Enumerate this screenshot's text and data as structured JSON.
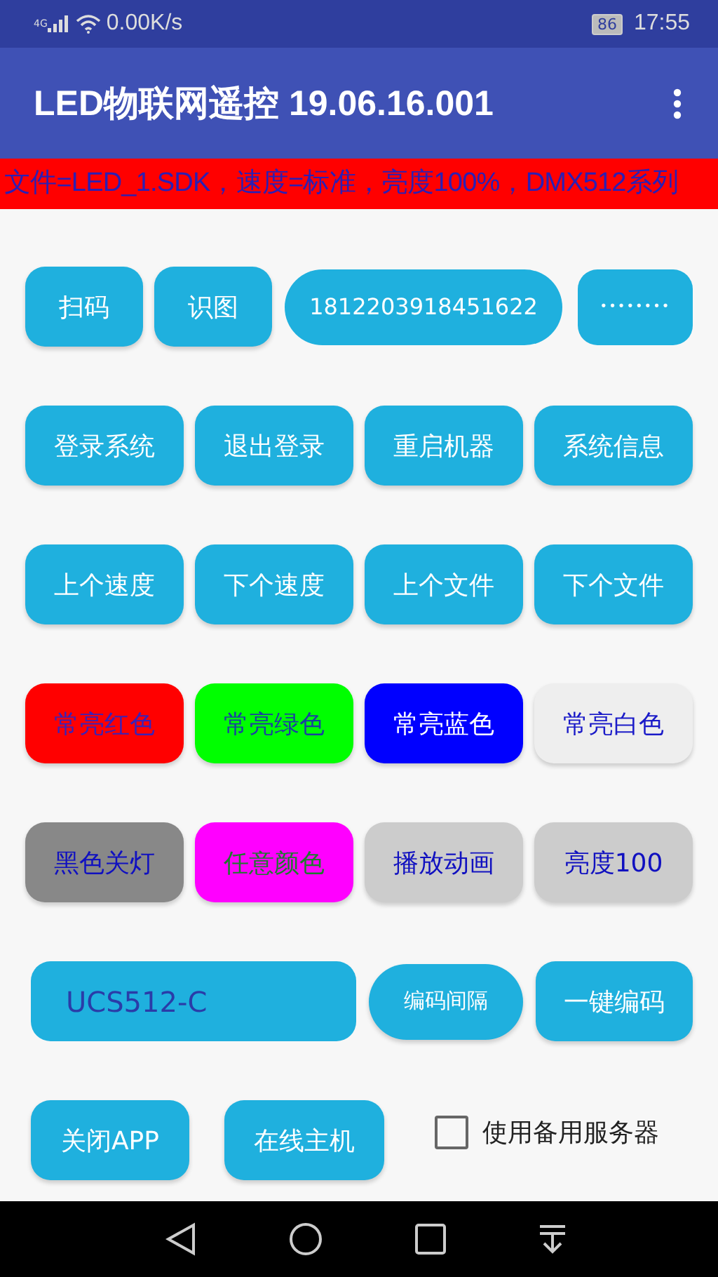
{
  "status_bar": {
    "network": "4G",
    "speed": "0.00K/s",
    "battery": "86",
    "time": "17:55"
  },
  "app_bar": {
    "title": "LED物联网遥控 19.06.16.001"
  },
  "info_banner": "文件=LED_1.SDK，速度=标准，亮度100%，DMX512系列",
  "rows": [
    {
      "items": [
        {
          "kind": "button",
          "label": "扫码"
        },
        {
          "kind": "button",
          "label": "识图"
        },
        {
          "kind": "field",
          "value": "1812203918451622"
        },
        {
          "kind": "password",
          "value": "••••••••"
        }
      ]
    },
    {
      "items": [
        {
          "kind": "button",
          "label": "登录系统"
        },
        {
          "kind": "button",
          "label": "退出登录"
        },
        {
          "kind": "button",
          "label": "重启机器"
        },
        {
          "kind": "button",
          "label": "系统信息"
        }
      ]
    },
    {
      "items": [
        {
          "kind": "button",
          "label": "上个速度"
        },
        {
          "kind": "button",
          "label": "下个速度"
        },
        {
          "kind": "button",
          "label": "上个文件"
        },
        {
          "kind": "button",
          "label": "下个文件"
        }
      ]
    },
    {
      "items": [
        {
          "kind": "button",
          "label": "常亮红色",
          "color": "#ff0000",
          "label_style": {
            "color": "#3a22b8"
          }
        },
        {
          "kind": "button",
          "label": "常亮绿色",
          "color": "#00ff00",
          "label_style": {
            "color": "#1a40a0"
          }
        },
        {
          "kind": "button",
          "label": "常亮蓝色",
          "color": "#0000ff",
          "label_style": {
            "color": "#ffffff"
          }
        },
        {
          "kind": "button",
          "label": "常亮白色",
          "color": "#eeeeee",
          "label_style": {
            "color": "#1a1ac8"
          }
        }
      ]
    },
    {
      "items": [
        {
          "kind": "button",
          "label": "黑色关灯",
          "color": "#888888",
          "label_style": {
            "color": "#1010c0"
          }
        },
        {
          "kind": "button",
          "label": "任意颜色",
          "color": "#ff00ff",
          "label_style": {
            "color": "#1f7a2e"
          }
        },
        {
          "kind": "button",
          "label": "播放动画",
          "color": "#cccccc",
          "label_style": {
            "color": "#1010c0"
          }
        },
        {
          "kind": "button",
          "label": "亮度100",
          "color": "#cccccc",
          "label_style": {
            "color": "#1010c0"
          }
        }
      ]
    },
    {
      "items": [
        {
          "kind": "field",
          "value": "UCS512-C"
        },
        {
          "kind": "pill",
          "label": "编码间隔"
        },
        {
          "kind": "button",
          "label": "一键编码"
        }
      ]
    },
    {
      "items": [
        {
          "kind": "button",
          "label": "关闭APP"
        },
        {
          "kind": "button",
          "label": "在线主机"
        },
        {
          "kind": "checkbox",
          "label": "使用备用服务器",
          "checked": false
        }
      ]
    }
  ]
}
